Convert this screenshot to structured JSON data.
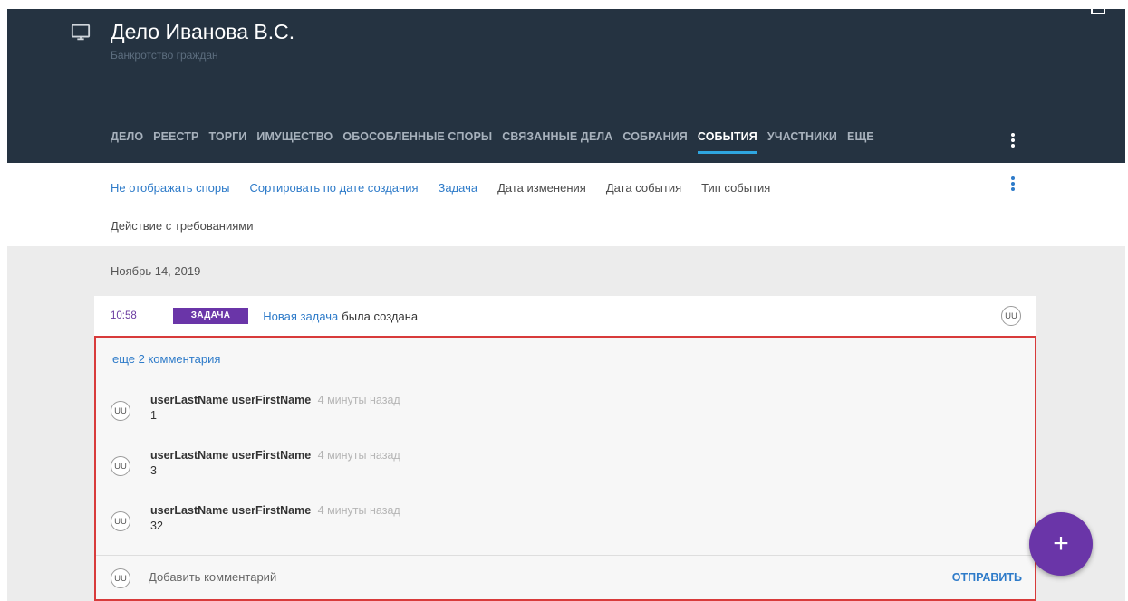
{
  "header": {
    "title": "Дело Иванова В.С.",
    "subtitle": "Банкротство граждан",
    "icon": "monitor-icon",
    "tabs": [
      {
        "label": "ДЕЛО"
      },
      {
        "label": "РЕЕСТР"
      },
      {
        "label": "ТОРГИ"
      },
      {
        "label": "ИМУЩЕСТВО"
      },
      {
        "label": "ОБОСОБЛЕННЫЕ СПОРЫ"
      },
      {
        "label": "СВЯЗАННЫЕ ДЕЛА"
      },
      {
        "label": "СОБРАНИЯ"
      },
      {
        "label": "СОБЫТИЯ",
        "active": true
      },
      {
        "label": "УЧАСТНИКИ"
      },
      {
        "label": "ЕЩЕ"
      }
    ]
  },
  "toolbar": {
    "filters": [
      {
        "label": "Не отображать споры"
      },
      {
        "label": "Сортировать по дате создания"
      },
      {
        "label": "Задача"
      },
      {
        "label": "Дата изменения"
      },
      {
        "label": "Дата события"
      },
      {
        "label": "Тип события"
      }
    ],
    "action_filter": "Действие с требованиями"
  },
  "feed": {
    "date": "Ноябрь 14, 2019",
    "event": {
      "time": "10:58",
      "badge": "ЗАДАЧА",
      "link": "Новая задача",
      "text": "была создана",
      "avatar": "UU"
    },
    "comments": {
      "more_link": "еще 2 комментария",
      "items": [
        {
          "avatar": "UU",
          "author": "userLastName userFirstName",
          "time": "4 минуты назад",
          "text": "1"
        },
        {
          "avatar": "UU",
          "author": "userLastName userFirstName",
          "time": "4 минуты назад",
          "text": "3"
        },
        {
          "avatar": "UU",
          "author": "userLastName userFirstName",
          "time": "4 минуты назад",
          "text": "32"
        }
      ],
      "input_avatar": "UU",
      "input_placeholder": "Добавить комментарий",
      "send_label": "ОТПРАВИТЬ"
    }
  },
  "fab": {
    "label": "+"
  },
  "colors": {
    "header_bg": "#253341",
    "accent_blue": "#2e7bc9",
    "tab_indicator": "#2fa6e0",
    "purple": "#6a35a8",
    "highlight_border": "#d83b3b"
  }
}
